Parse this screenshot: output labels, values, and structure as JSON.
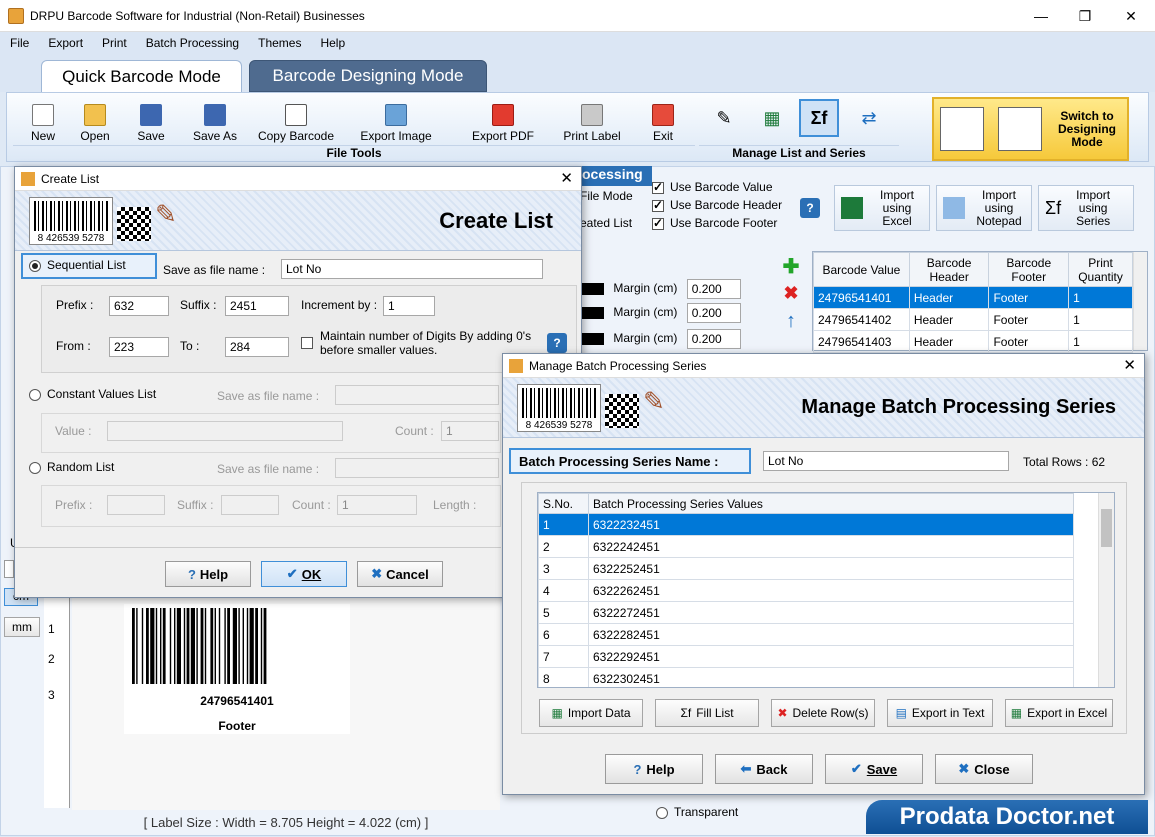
{
  "window": {
    "title": "DRPU Barcode Software for Industrial (Non-Retail) Businesses",
    "min": "—",
    "max": "❐",
    "close": "✕"
  },
  "menu": [
    "File",
    "Export",
    "Print",
    "Batch Processing",
    "Themes",
    "Help"
  ],
  "modes": {
    "quick": "Quick Barcode Mode",
    "designing": "Barcode Designing Mode"
  },
  "toolbar": {
    "items": [
      "New",
      "Open",
      "Save",
      "Save As",
      "Copy Barcode",
      "Export Image",
      "Export PDF",
      "Print Label",
      "Exit"
    ],
    "group1": "File Tools",
    "group2": "Manage List and Series"
  },
  "switch_btn": "Switch to Designing Mode",
  "batch": {
    "header": "ocessing",
    "file_mode": "File Mode",
    "created_list": "eated List",
    "use_value": "Use Barcode Value",
    "use_header": "Use Barcode Header",
    "use_footer": "Use Barcode Footer",
    "import_excel": "Import using Excel",
    "import_notepad": "Import using Notepad",
    "import_series": "Import using Series"
  },
  "margins": {
    "label": "Margin (cm)",
    "values": [
      "0.200",
      "0.200",
      "0.200"
    ]
  },
  "main_table": {
    "headers": [
      "Barcode Value",
      "Barcode Header",
      "Barcode Footer",
      "Print Quantity"
    ],
    "rows": [
      [
        "24796541401",
        "Header",
        "Footer",
        "1"
      ],
      [
        "24796541402",
        "Header",
        "Footer",
        "1"
      ],
      [
        "24796541403",
        "Header",
        "Footer",
        "1"
      ]
    ]
  },
  "preview": {
    "value": "24796541401",
    "footer": "Footer",
    "ruler": [
      "1",
      "2",
      "3"
    ],
    "unit": "mm",
    "unit2": "cm",
    "partial": "U"
  },
  "status": "[ Label Size : Width = 8.705  Height = 4.022 (cm) ]",
  "transparent": "Transparent",
  "create_list": {
    "title": "Create List",
    "banner": "Create List",
    "barcode_digits": "8 426539 5278",
    "sequential": "Sequential List",
    "save_as": "Save as file name :",
    "save_value": "Lot No",
    "prefix_lbl": "Prefix :",
    "prefix": "632",
    "suffix_lbl": "Suffix :",
    "suffix": "2451",
    "incr_lbl": "Increment by :",
    "incr": "1",
    "from_lbl": "From :",
    "from": "223",
    "to_lbl": "To :",
    "to": "284",
    "maintain": "Maintain number of Digits By adding 0's before smaller values.",
    "constant": "Constant Values List",
    "value_lbl": "Value :",
    "count_lbl": "Count :",
    "count": "1",
    "random": "Random List",
    "length_lbl": "Length :",
    "help": "Help",
    "ok": "OK",
    "cancel": "Cancel"
  },
  "mbps": {
    "title": "Manage Batch Processing Series",
    "banner": "Manage Batch Processing Series",
    "barcode_digits": "8 426539 5278",
    "name_lbl": "Batch Processing Series Name :",
    "name": "Lot No",
    "total": "Total Rows : 62",
    "headers": [
      "S.No.",
      "Batch Processing Series Values"
    ],
    "rows": [
      [
        "1",
        "6322232451"
      ],
      [
        "2",
        "6322242451"
      ],
      [
        "3",
        "6322252451"
      ],
      [
        "4",
        "6322262451"
      ],
      [
        "5",
        "6322272451"
      ],
      [
        "6",
        "6322282451"
      ],
      [
        "7",
        "6322292451"
      ],
      [
        "8",
        "6322302451"
      ]
    ],
    "import": "Import Data",
    "fill": "Fill List",
    "delete": "Delete Row(s)",
    "export_text": "Export in Text",
    "export_excel": "Export in Excel",
    "help": "Help",
    "back": "Back",
    "save": "Save",
    "close": "Close"
  },
  "watermark": "Prodata Doctor.net",
  "colors": {
    "accent": "#0078d7",
    "tab_inactive": "#4f6b8f",
    "header_blue": "#2a6fb5"
  }
}
